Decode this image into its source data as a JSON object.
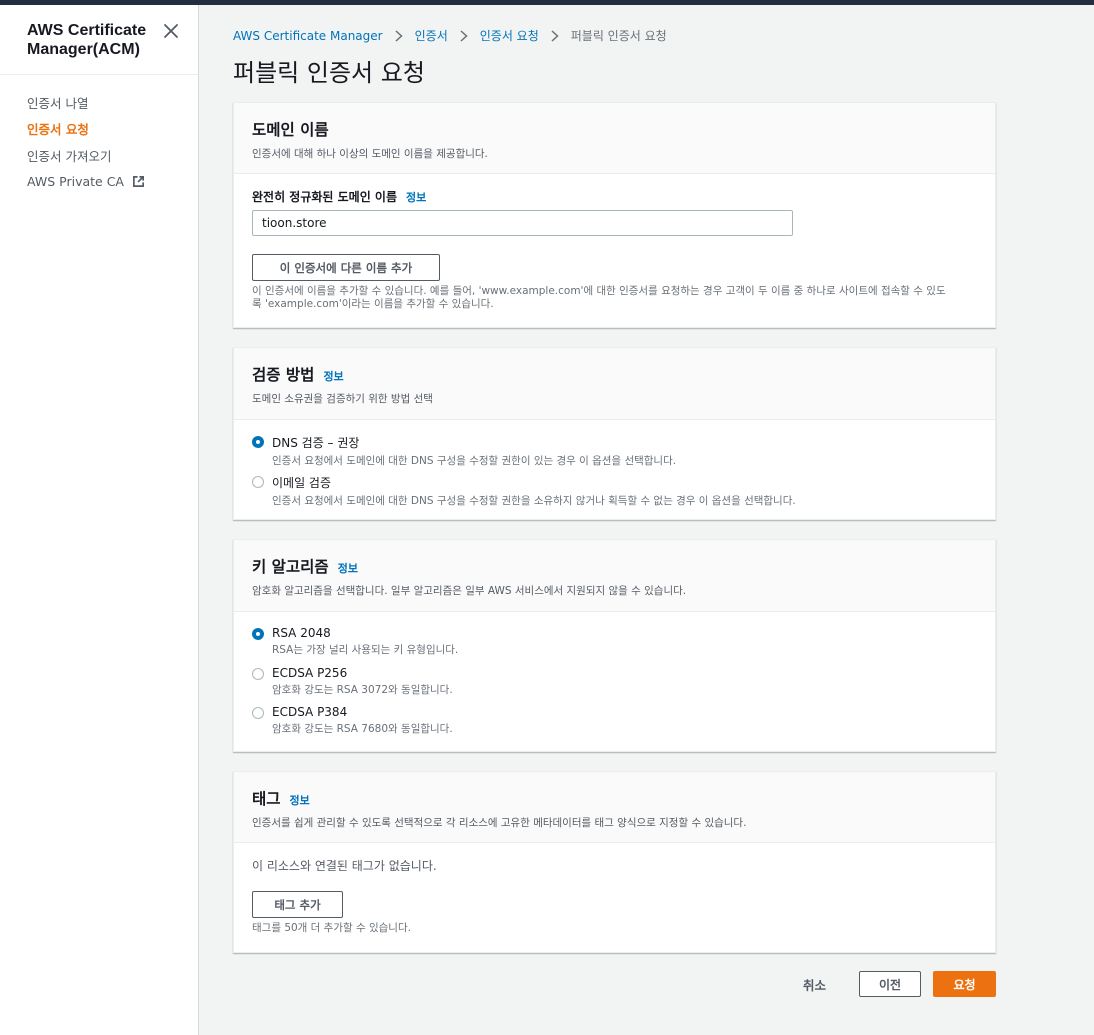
{
  "sidebar": {
    "title": "AWS Certificate Manager(ACM)",
    "items": [
      {
        "label": "인증서 나열"
      },
      {
        "label": "인증서 요청"
      },
      {
        "label": "인증서 가져오기"
      },
      {
        "label": "AWS Private CA"
      }
    ]
  },
  "breadcrumb": {
    "items": [
      "AWS Certificate Manager",
      "인증서",
      "인증서 요청",
      "퍼블릭 인증서 요청"
    ]
  },
  "page": {
    "title": "퍼블릭 인증서 요청"
  },
  "info_label": "정보",
  "domain_section": {
    "title": "도메인 이름",
    "description": "인증서에 대해 하나 이상의 도메인 이름을 제공합니다.",
    "field_label": "완전히 정규화된 도메인 이름",
    "field_value": "tioon.store",
    "add_name_button": "이 인증서에 다른 이름 추가",
    "hint_line1": "이 인증서에 이름을 추가할 수 있습니다. 예를 들어, 'www.example.com'에 대한 인증서를 요청하는 경우 고객이 두 이름 중 하나로 사이트에 접속할 수 있도",
    "hint_line2": "록 'example.com'이라는 이름을 추가할 수 있습니다."
  },
  "validation_section": {
    "title": "검증 방법",
    "description": "도메인 소유권을 검증하기 위한 방법 선택",
    "options": [
      {
        "label": "DNS 검증 – 권장",
        "description": "인증서 요청에서 도메인에 대한 DNS 구성을 수정할 권한이 있는 경우 이 옵션을 선택합니다.",
        "checked": true
      },
      {
        "label": "이메일 검증",
        "description": "인증서 요청에서 도메인에 대한 DNS 구성을 수정할 권한을 소유하지 않거나 획득할 수 없는 경우 이 옵션을 선택합니다.",
        "checked": false
      }
    ]
  },
  "key_section": {
    "title": "키 알고리즘",
    "description": "암호화 알고리즘을 선택합니다. 일부 알고리즘은 일부 AWS 서비스에서 지원되지 않을 수 있습니다.",
    "options": [
      {
        "label": "RSA 2048",
        "description": "RSA는 가장 널리 사용되는 키 유형입니다.",
        "checked": true
      },
      {
        "label": "ECDSA P256",
        "description": "암호화 강도는 RSA 3072와 동일합니다.",
        "checked": false
      },
      {
        "label": "ECDSA P384",
        "description": "암호화 강도는 RSA 7680와 동일합니다.",
        "checked": false
      }
    ]
  },
  "tags_section": {
    "title": "태그",
    "description": "인증서를 쉽게 관리할 수 있도록 선택적으로 각 리소스에 고유한 메타데이터를 태그 양식으로 지정할 수 있습니다.",
    "empty_text": "이 리소스와 연결된 태그가 없습니다.",
    "add_tag_button": "태그 추가",
    "limit_hint": "태그를 50개 더 추가할 수 있습니다."
  },
  "footer": {
    "cancel": "취소",
    "previous": "이전",
    "submit": "요청"
  },
  "colors": {
    "accent": "#ec7211",
    "link": "#0073bb",
    "nav_dark": "#232f3e"
  }
}
